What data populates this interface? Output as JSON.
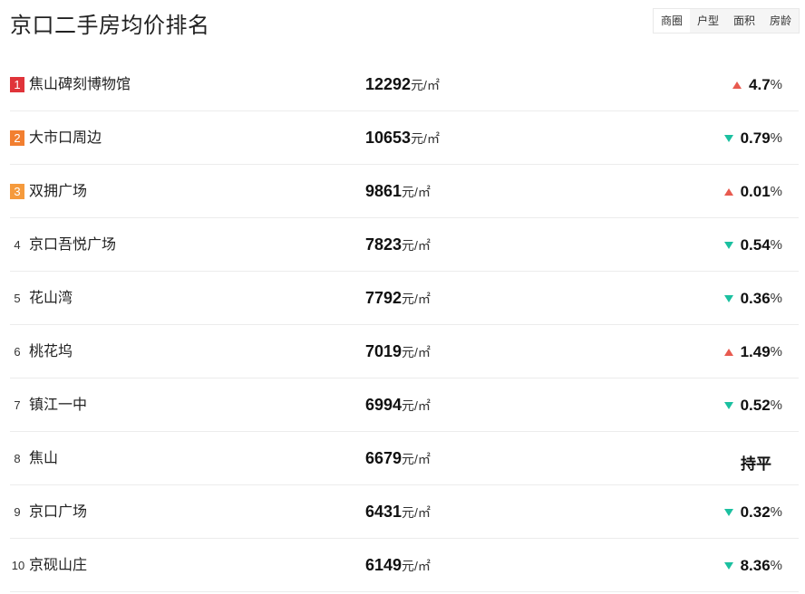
{
  "header": {
    "title": "京口二手房均价排名",
    "tabs": [
      {
        "label": "商圈",
        "active": true
      },
      {
        "label": "户型",
        "active": false
      },
      {
        "label": "面积",
        "active": false
      },
      {
        "label": "房龄",
        "active": false
      }
    ]
  },
  "colors": {
    "rank1": "#e0343a",
    "rank2": "#f27f30",
    "rank3": "#f59a3c",
    "up": "#e85a4f",
    "down": "#1bc0a0"
  },
  "unit": "元/㎡",
  "pct_sign": "%",
  "rows": [
    {
      "rank": "1",
      "name": "焦山碑刻博物馆",
      "price": "12292",
      "trend": "up",
      "change": "4.7"
    },
    {
      "rank": "2",
      "name": "大市口周边",
      "price": "10653",
      "trend": "down",
      "change": "0.79"
    },
    {
      "rank": "3",
      "name": "双拥广场",
      "price": "9861",
      "trend": "up",
      "change": "0.01"
    },
    {
      "rank": "4",
      "name": "京口吾悦广场",
      "price": "7823",
      "trend": "down",
      "change": "0.54"
    },
    {
      "rank": "5",
      "name": "花山湾",
      "price": "7792",
      "trend": "down",
      "change": "0.36"
    },
    {
      "rank": "6",
      "name": "桃花坞",
      "price": "7019",
      "trend": "up",
      "change": "1.49"
    },
    {
      "rank": "7",
      "name": "镇江一中",
      "price": "6994",
      "trend": "down",
      "change": "0.52"
    },
    {
      "rank": "8",
      "name": "焦山",
      "price": "6679",
      "trend": "flat",
      "change": "持平"
    },
    {
      "rank": "9",
      "name": "京口广场",
      "price": "6431",
      "trend": "down",
      "change": "0.32"
    },
    {
      "rank": "10",
      "name": "京砚山庄",
      "price": "6149",
      "trend": "down",
      "change": "8.36"
    }
  ]
}
